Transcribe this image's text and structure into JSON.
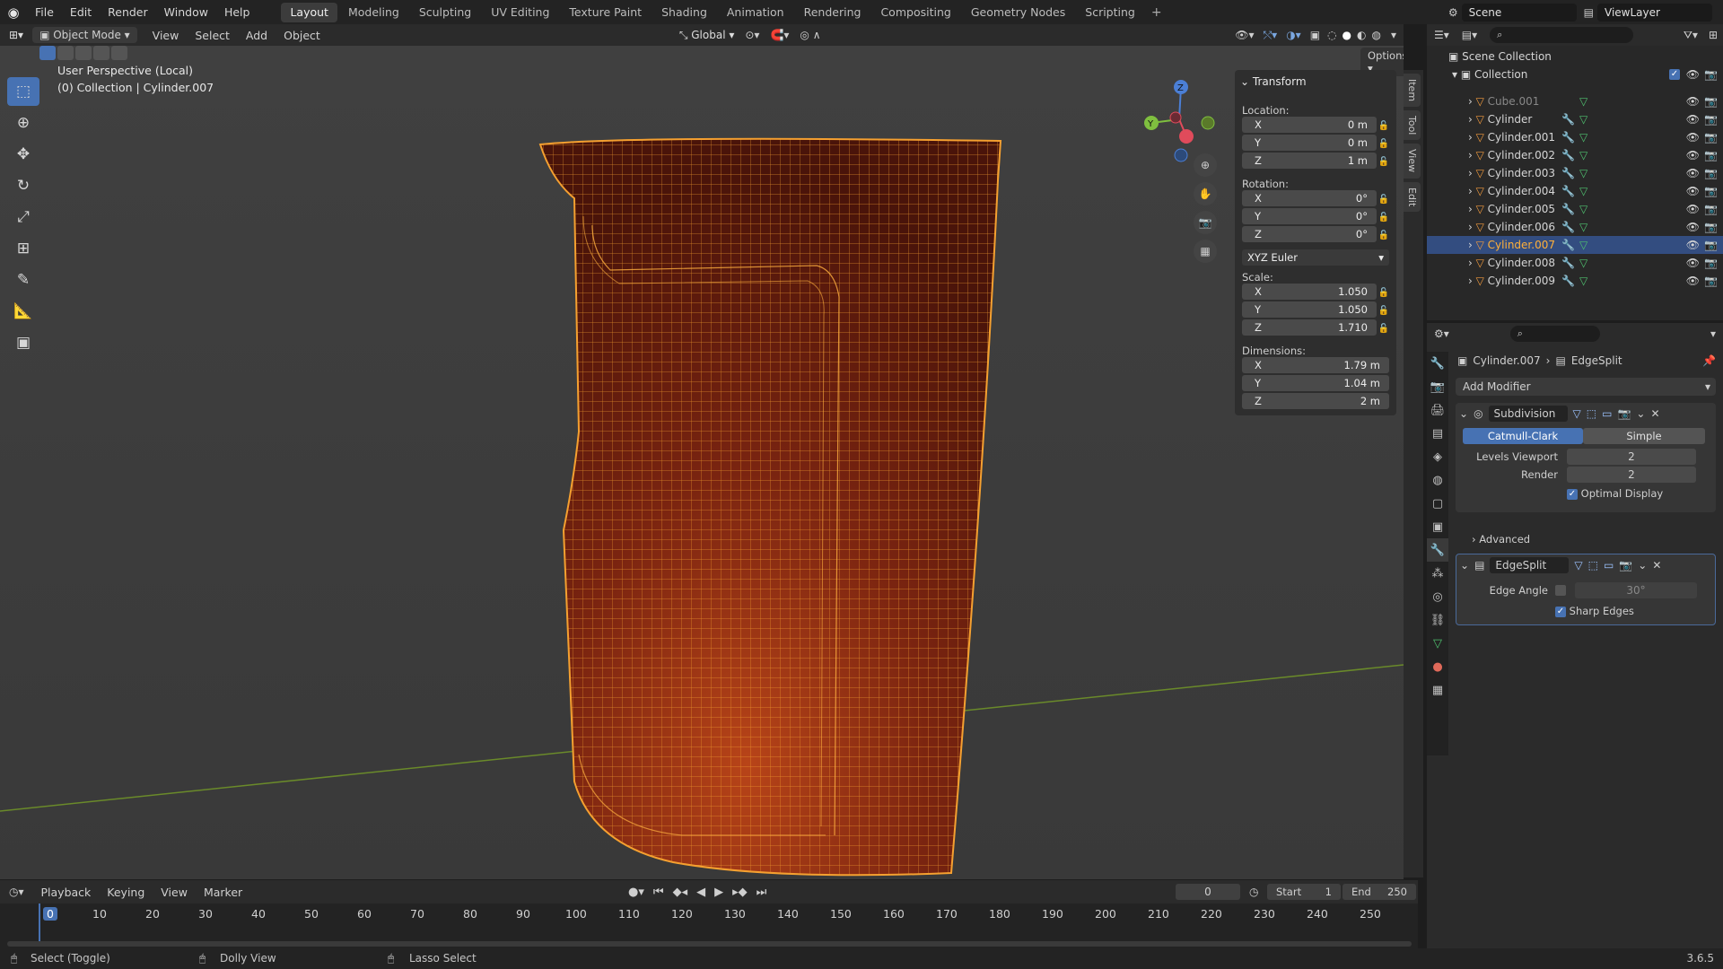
{
  "top_menu": [
    "File",
    "Edit",
    "Render",
    "Window",
    "Help"
  ],
  "workspaces": [
    "Layout",
    "Modeling",
    "Sculpting",
    "UV Editing",
    "Texture Paint",
    "Shading",
    "Animation",
    "Rendering",
    "Compositing",
    "Geometry Nodes",
    "Scripting"
  ],
  "active_workspace": "Layout",
  "scene_name": "Scene",
  "view_layer": "ViewLayer",
  "header": {
    "mode": "Object Mode",
    "menus": [
      "View",
      "Select",
      "Add",
      "Object"
    ],
    "orientation": "Global",
    "options": "Options"
  },
  "viewport": {
    "title": "User Perspective (Local)",
    "subtitle": "(0) Collection | Cylinder.007",
    "gizmo": {
      "z": "Z",
      "y": "Y"
    }
  },
  "transform": {
    "title": "Transform",
    "location_label": "Location:",
    "rotation_label": "Rotation:",
    "scale_label": "Scale:",
    "dimensions_label": "Dimensions:",
    "location": [
      {
        "axis": "X",
        "value": "0 m"
      },
      {
        "axis": "Y",
        "value": "0 m"
      },
      {
        "axis": "Z",
        "value": "1 m"
      }
    ],
    "rotation": [
      {
        "axis": "X",
        "value": "0°"
      },
      {
        "axis": "Y",
        "value": "0°"
      },
      {
        "axis": "Z",
        "value": "0°"
      }
    ],
    "rotation_mode": "XYZ Euler",
    "scale": [
      {
        "axis": "X",
        "value": "1.050"
      },
      {
        "axis": "Y",
        "value": "1.050"
      },
      {
        "axis": "Z",
        "value": "1.710"
      }
    ],
    "dimensions": [
      {
        "axis": "X",
        "value": "1.79 m"
      },
      {
        "axis": "Y",
        "value": "1.04 m"
      },
      {
        "axis": "Z",
        "value": "2 m"
      }
    ]
  },
  "side_tabs": [
    "Item",
    "Tool",
    "View",
    "Edit"
  ],
  "outliner": {
    "scene_collection": "Scene Collection",
    "collection": "Collection",
    "objects": [
      "Cube.001",
      "Cylinder",
      "Cylinder.001",
      "Cylinder.002",
      "Cylinder.003",
      "Cylinder.004",
      "Cylinder.005",
      "Cylinder.006",
      "Cylinder.007",
      "Cylinder.008",
      "Cylinder.009"
    ],
    "selected": "Cylinder.007"
  },
  "properties": {
    "object": "Cylinder.007",
    "modifier_crumb": "EdgeSplit",
    "add_modifier": "Add Modifier",
    "subdivision": {
      "name": "Subdivision",
      "catmull": "Catmull-Clark",
      "simple": "Simple",
      "levels_viewport_label": "Levels Viewport",
      "levels_viewport": "2",
      "render_label": "Render",
      "render": "2",
      "optimal_display": "Optimal Display",
      "advanced": "Advanced"
    },
    "edgesplit": {
      "name": "EdgeSplit",
      "edge_angle_label": "Edge Angle",
      "edge_angle": "30°",
      "sharp_edges": "Sharp Edges"
    }
  },
  "timeline": {
    "menus": [
      "Playback",
      "Keying",
      "View",
      "Marker"
    ],
    "current_frame": "0",
    "start_label": "Start",
    "start": "1",
    "end_label": "End",
    "end": "250",
    "ticks": [
      "0",
      "10",
      "20",
      "30",
      "40",
      "50",
      "60",
      "70",
      "80",
      "90",
      "100",
      "110",
      "120",
      "130",
      "140",
      "150",
      "160",
      "170",
      "180",
      "190",
      "200",
      "210",
      "220",
      "230",
      "240",
      "250"
    ]
  },
  "status": {
    "select": "Select (Toggle)",
    "dolly": "Dolly View",
    "lasso": "Lasso Select",
    "version": "3.6.5"
  },
  "colors": {
    "accent": "#4772b3",
    "selection_orange": "#f5a030",
    "mesh_fill": "#8a2a10"
  }
}
